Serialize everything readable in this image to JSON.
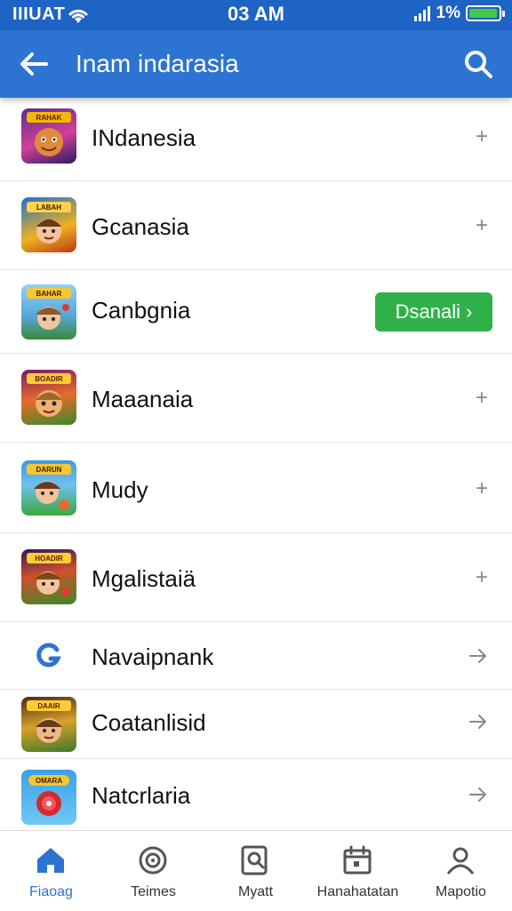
{
  "status_bar": {
    "carrier": "IIIUAT",
    "time": "03 AM",
    "battery_text": "1%",
    "battery_level": 0.85
  },
  "app_bar": {
    "title": "Inam indarasia",
    "back_icon": "arrow-left-icon",
    "search_icon": "search-icon"
  },
  "items": [
    {
      "label": "INdanesia",
      "thumb_text": "RAHAK",
      "action": "plus"
    },
    {
      "label": "Gcanasia",
      "thumb_text": "LABAH",
      "action": "plus"
    },
    {
      "label": "Canbgnia",
      "thumb_text": "BAHAR",
      "action": "button",
      "button_label": "Dsanali ›"
    },
    {
      "label": "Maaanaia",
      "thumb_text": "BOADIR",
      "action": "plus"
    },
    {
      "label": "Mudy",
      "thumb_text": "DARUN",
      "action": "plus"
    },
    {
      "label": "Mgalistaiä",
      "thumb_text": "HOADIR",
      "action": "plus"
    },
    {
      "label": "Navaipnank",
      "thumb_text": "",
      "action": "arrow"
    },
    {
      "label": "Coatanlisid",
      "thumb_text": "DAAIR",
      "action": "arrow"
    },
    {
      "label": "Natcrlaria",
      "thumb_text": "OMARA",
      "action": "arrow"
    }
  ],
  "tabs": [
    {
      "label": "Fiaoag",
      "icon": "home-icon",
      "active": true
    },
    {
      "label": "Teimes",
      "icon": "target-icon",
      "active": false
    },
    {
      "label": "Myatt",
      "icon": "search-doc-icon",
      "active": false
    },
    {
      "label": "Hanahatatan",
      "icon": "calendar-icon",
      "active": false
    },
    {
      "label": "Mapotio",
      "icon": "profile-icon",
      "active": false
    }
  ],
  "colors": {
    "header": "#2d74d2",
    "status": "#1e63c6",
    "accent_green": "#2fb14a",
    "tab_active": "#2d74d2"
  }
}
